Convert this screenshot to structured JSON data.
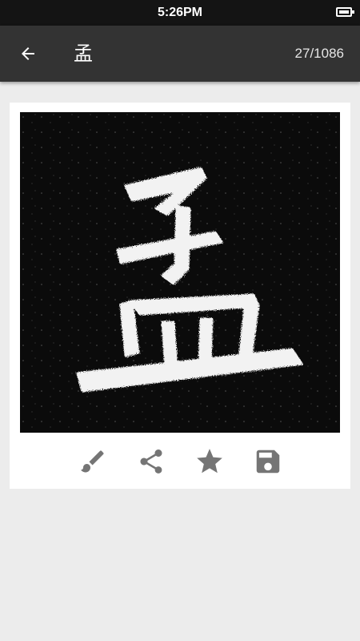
{
  "status_bar": {
    "time": "5:26PM"
  },
  "app_bar": {
    "title": "孟",
    "counter": "27/1086"
  },
  "image": {
    "character": "孟"
  },
  "actions": [
    {
      "icon": "brush-icon"
    },
    {
      "icon": "share-icon"
    },
    {
      "icon": "star-icon"
    },
    {
      "icon": "save-icon"
    }
  ],
  "colors": {
    "status_bar": "#141414",
    "app_bar": "#333333",
    "background": "#ececec",
    "icon_gray": "#757575"
  }
}
